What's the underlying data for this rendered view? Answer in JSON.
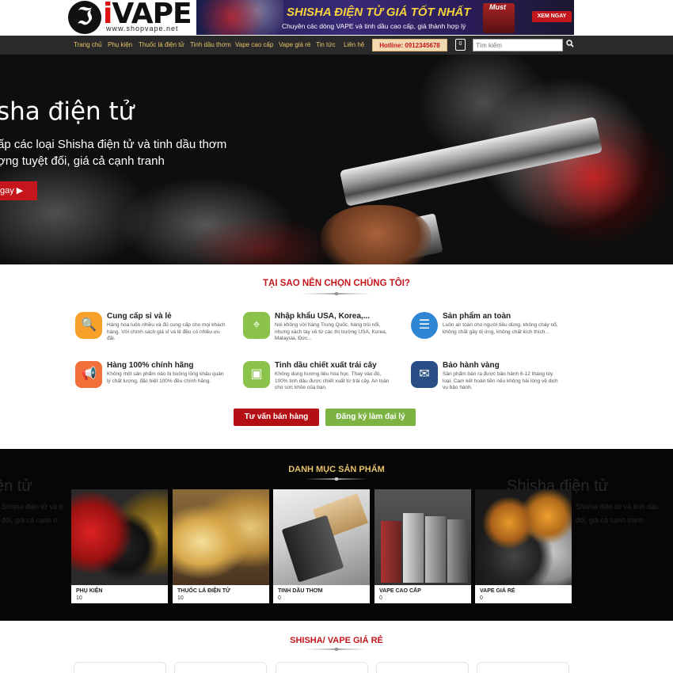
{
  "header": {
    "logo_icon": "ℑ",
    "logo_text_i": "i",
    "logo_text_rest": "VAPE",
    "logo_url": "www.shopvape.net",
    "banner": {
      "title": "SHISHA ĐIỆN TỬ GIÁ TỐT NHẤT",
      "subtitle": "Chuyên các dòng VAPE và tinh dầu cao cấp, giá thành hợp lý",
      "product_label": "Must",
      "cta": "XEM NGAY"
    }
  },
  "nav": {
    "items": [
      "Trang chủ",
      "Phụ kiện",
      "Thuốc lá điện tử",
      "Tinh dầu thơm",
      "Vape cao cấp",
      "Vape giá rẻ",
      "Tin tức",
      "Liên hệ"
    ],
    "hotline": "Hotline: 0912345678",
    "cart_count": "0",
    "search_placeholder": "Tìm kiếm",
    "search_icon": "magnifier-icon"
  },
  "hero": {
    "title": "sha điện tử",
    "line1": "ấp các loại Shisha điện tử và tinh dầu thơm",
    "line2": "ợng tuyệt đối, giá cả cạnh tranh",
    "button": "gay ▶"
  },
  "why": {
    "title": "TẠI SAO NÊN CHỌN CHÚNG TÔI?",
    "features": [
      {
        "title": "Cung cấp sỉ và lẻ",
        "desc": "Hàng hóa luôn nhiều và đủ cung cấp cho mọi khách hàng. Với chính sách giá sỉ và lẻ đều có nhiều ưu đãi.",
        "icon": "🔍",
        "color": "#f7a12a"
      },
      {
        "title": "Nhập khẩu USA, Korea,...",
        "desc": "Nói không với hàng Trung Quốc, hàng trôi nổi, nhưng xách tay về từ các thị trường USA, Korea, Malaysia, Đức...",
        "icon": "⌖",
        "color": "#8bc34a"
      },
      {
        "title": "Sản phẩm an toàn",
        "desc": "Luôn an toàn cho người tiêu dùng, không cháy nổ, không chất gây dị ứng, không chất kích thích...",
        "icon": "☰",
        "color": "#2f86d4"
      },
      {
        "title": "Hàng 100% chính hãng",
        "desc": "Không một sản phẩm nào bị buông lỏng khâu quản lý chất lượng, đặc biệt 100% đều chính hãng.",
        "icon": "📢",
        "color": "#f2713a"
      },
      {
        "title": "Tinh dầu chiết xuất trái cây",
        "desc": "Không dùng hương liệu hóa học. Thay vào đó, 100% tinh dầu được chiết xuất từ trái cây. An toàn cho sức khỏe của bạn.",
        "icon": "▣",
        "color": "#8bc34a"
      },
      {
        "title": "Bảo hành vàng",
        "desc": "Sản phẩm bán ra được bảo hành 6-12 tháng tùy loại. Cam kết hoàn tiền nếu không hài lòng về dịch vụ bảo hành.",
        "icon": "✉",
        "color": "#2a4f86"
      }
    ],
    "button_consult": "Tư vấn bán hàng",
    "button_agent": "Đăng ký làm đại lý"
  },
  "categories": {
    "title": "DANH MỤC SẢN PHẨM",
    "bg_title": "Shisha điện tử",
    "bg_line1": "Shisha điện tử và tinh dầu",
    "bg_line2": "đối, giá cả cạnh tranh",
    "bg_left_title": "ện tử",
    "bg_left_line1": "Shisha điện tử và ti",
    "bg_left_line2": "đối, giá cả cạnh tr",
    "items": [
      {
        "name": "Phụ kiện",
        "count": "10"
      },
      {
        "name": "Thuốc lá điện tử",
        "count": "10"
      },
      {
        "name": "Tinh dầu thơm",
        "count": "0"
      },
      {
        "name": "Vape cao cấp",
        "count": "0"
      },
      {
        "name": "Vape giá rẻ",
        "count": "0"
      }
    ]
  },
  "cheap": {
    "title": "SHISHA/ VAPE GIÁ RẺ"
  }
}
